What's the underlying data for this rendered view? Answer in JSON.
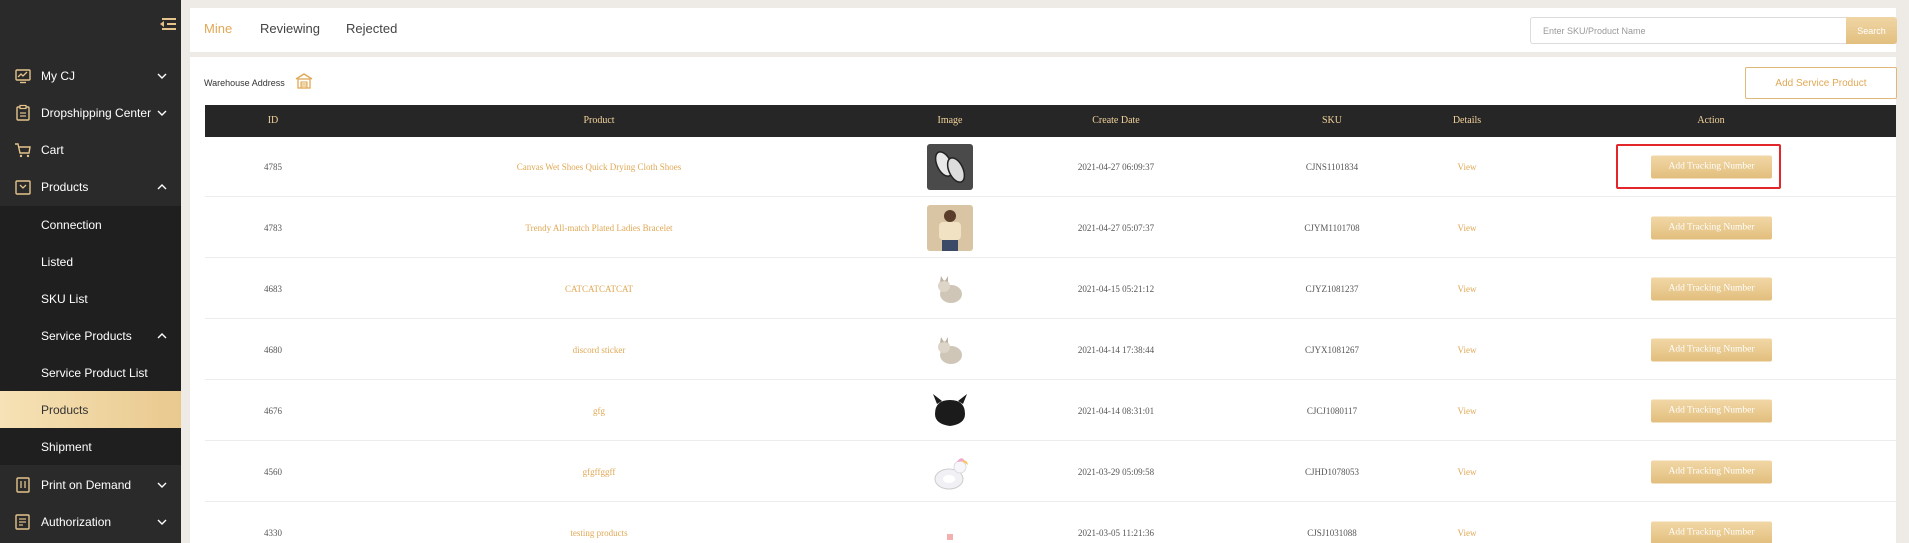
{
  "sidebar": {
    "items": [
      {
        "label": "My CJ",
        "icon": "monitor-chart-icon",
        "expanded": false
      },
      {
        "label": "Dropshipping Center",
        "icon": "clipboard-icon",
        "expanded": false
      },
      {
        "label": "Cart",
        "icon": "cart-icon"
      },
      {
        "label": "Products",
        "icon": "package-box-icon",
        "expanded": true
      },
      {
        "label": "Print on Demand",
        "icon": "print-tag-icon",
        "expanded": false
      },
      {
        "label": "Authorization",
        "icon": "authorization-list-icon",
        "expanded": false
      }
    ],
    "products_sub": [
      {
        "label": "Connection"
      },
      {
        "label": "Listed"
      },
      {
        "label": "SKU List"
      },
      {
        "label": "Service Products",
        "expanded": true
      },
      {
        "label": "Service Product List"
      },
      {
        "label": "Products",
        "active": true
      },
      {
        "label": "Shipment"
      }
    ]
  },
  "tabs": [
    {
      "label": "Mine",
      "active": true
    },
    {
      "label": "Reviewing"
    },
    {
      "label": "Rejected"
    }
  ],
  "search": {
    "placeholder": "Enter SKU/Product Name",
    "button": "Search"
  },
  "warehouse": {
    "label": "Warehouse Address",
    "icon": "warehouse-icon"
  },
  "add_service_product": "Add Service Product",
  "table": {
    "columns": [
      "ID",
      "Product",
      "Image",
      "Create Date",
      "SKU",
      "Details",
      "Action"
    ],
    "rows": [
      {
        "id": "4785",
        "product": "Canvas Wet Shoes Quick Drying Cloth Shoes",
        "image": "shoes",
        "date": "2021-04-27 06:09:37",
        "sku": "CJNS1101834",
        "details": "View",
        "action": "Add Tracking Number"
      },
      {
        "id": "4783",
        "product": "Trendy All-match Plated Ladies Bracelet",
        "image": "person",
        "date": "2021-04-27 05:07:37",
        "sku": "CJYM1101708",
        "details": "View",
        "action": "Add Tracking Number"
      },
      {
        "id": "4683",
        "product": "CATCATCATCAT",
        "image": "cat",
        "date": "2021-04-15 05:21:12",
        "sku": "CJYZ1081237",
        "details": "View",
        "action": "Add Tracking Number"
      },
      {
        "id": "4680",
        "product": "discord sticker",
        "image": "cat",
        "date": "2021-04-14 17:38:44",
        "sku": "CJYX1081267",
        "details": "View",
        "action": "Add Tracking Number"
      },
      {
        "id": "4676",
        "product": "gfg",
        "image": "hat",
        "date": "2021-04-14 08:31:01",
        "sku": "CJCJ1080117",
        "details": "View",
        "action": "Add Tracking Number"
      },
      {
        "id": "4560",
        "product": "gfgffggff",
        "image": "unicorn",
        "date": "2021-03-29 05:09:58",
        "sku": "CJHD1078053",
        "details": "View",
        "action": "Add Tracking Number"
      },
      {
        "id": "4330",
        "product": "testing products",
        "image": "small",
        "date": "2021-03-05 11:21:36",
        "sku": "CJSJ1031088",
        "details": "View",
        "action": "Add Tracking Number"
      }
    ]
  },
  "colors": {
    "accent": "#e0a855",
    "sidebar": "#2a2a2a",
    "header": "#262626",
    "highlight": "#e3262a"
  }
}
